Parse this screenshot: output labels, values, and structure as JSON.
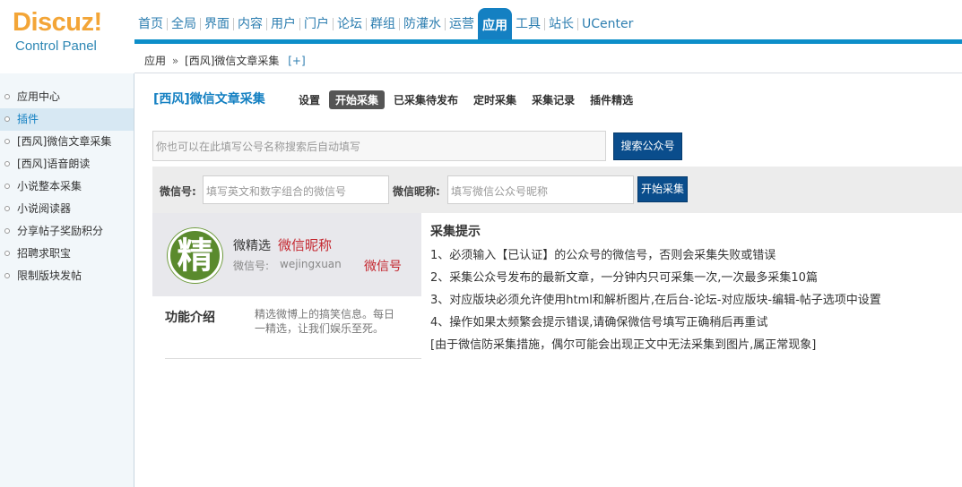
{
  "logo": {
    "main": "Discuz!",
    "sub": "Control Panel"
  },
  "nav": [
    {
      "label": "首页"
    },
    {
      "label": "全局"
    },
    {
      "label": "界面"
    },
    {
      "label": "内容"
    },
    {
      "label": "用户"
    },
    {
      "label": "门户"
    },
    {
      "label": "论坛"
    },
    {
      "label": "群组"
    },
    {
      "label": "防灌水"
    },
    {
      "label": "运营"
    },
    {
      "label": "应用",
      "active": true
    },
    {
      "label": "工具"
    },
    {
      "label": "站长"
    },
    {
      "label": "UCenter"
    }
  ],
  "breadcrumb": {
    "root": "应用",
    "sep": "»",
    "current": "[西风]微信文章采集",
    "plus": "[+]"
  },
  "sidebar": {
    "items": [
      {
        "label": "应用中心"
      },
      {
        "label": "插件",
        "active": true
      },
      {
        "label": "[西风]微信文章采集"
      },
      {
        "label": "[西风]语音朗读"
      },
      {
        "label": "小说整本采集"
      },
      {
        "label": "小说阅读器"
      },
      {
        "label": "分享帖子奖励积分"
      },
      {
        "label": "招聘求职宝"
      },
      {
        "label": "限制版块发帖"
      }
    ]
  },
  "plugin": {
    "title": "[西风]微信文章采集",
    "tabs": [
      {
        "label": "设置"
      },
      {
        "label": "开始采集",
        "active": true
      },
      {
        "label": "已采集待发布"
      },
      {
        "label": "定时采集"
      },
      {
        "label": "采集记录"
      },
      {
        "label": "插件精选"
      }
    ]
  },
  "search": {
    "placeholder": "你也可以在此填写公号名称搜索后自动填写",
    "button": "搜索公众号"
  },
  "form": {
    "wechat_id_label": "微信号:",
    "wechat_id_placeholder": "填写英文和数字组合的微信号",
    "nickname_label": "微信昵称:",
    "nickname_placeholder": "填写微信公众号昵称",
    "start_button": "开始采集"
  },
  "card": {
    "avatar_char": "精",
    "name": "微精选",
    "nickname": "微信昵称",
    "id_label": "微信号:",
    "id_value": "wejingxuan",
    "id_red": "微信号"
  },
  "intro": {
    "title": "功能介绍",
    "text": "精选微博上的搞笑信息。每日一精选，让我们娱乐至死。"
  },
  "tips": {
    "title": "采集提示",
    "lines": [
      "1、必须输入【已认证】的公众号的微信号，否则会采集失败或错误",
      "2、采集公众号发布的最新文章，一分钟内只可采集一次,一次最多采集10篇",
      "3、对应版块必须允许使用html和解析图片,在后台-论坛-对应版块-编辑-帖子选项中设置",
      "4、操作如果太频繁会提示错误,请确保微信号填写正确稍后再重试",
      "[由于微信防采集措施，偶尔可能会出现正文中无法采集到图片,属正常现象]"
    ]
  }
}
